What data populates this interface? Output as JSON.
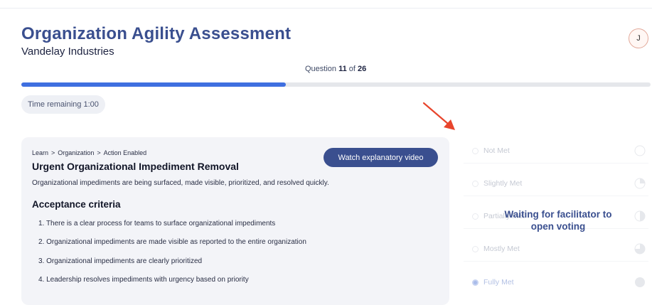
{
  "header": {
    "title": "Organization Agility Assessment",
    "organization": "Vandelay Industries",
    "avatar_initial": "J"
  },
  "progress": {
    "label_prefix": "Question",
    "current": "11",
    "label_of": "of",
    "total": "26",
    "fraction": 0.42
  },
  "timer": {
    "label": "Time remaining 1:00"
  },
  "arrow_color": "#e8452c",
  "card": {
    "breadcrumb": [
      "Learn",
      "Organization",
      "Action Enabled"
    ],
    "breadcrumb_separator": ">",
    "video_button_label": "Watch explanatory video",
    "title": "Urgent Organizational Impediment Removal",
    "description": "Organizational impediments are being surfaced, made visible, prioritized, and resolved quickly.",
    "criteria_heading": "Acceptance criteria",
    "criteria": [
      "1. There is a clear process for teams to surface organizational impediments",
      "2. Organizational impediments are made visible as reported to the entire organization",
      "3. Organizational impediments are clearly prioritized",
      "4. Leadership resolves impediments with urgency based on priority"
    ]
  },
  "voting": {
    "waiting_message": "Waiting for facilitator to open voting",
    "options": [
      {
        "label": "Not Met",
        "selected": false,
        "level": 0
      },
      {
        "label": "Slightly Met",
        "selected": false,
        "level": 0.25
      },
      {
        "label": "Partially Met",
        "selected": false,
        "level": 0.5
      },
      {
        "label": "Mostly Met",
        "selected": false,
        "level": 0.75
      },
      {
        "label": "Fully Met",
        "selected": true,
        "level": 1
      }
    ]
  }
}
